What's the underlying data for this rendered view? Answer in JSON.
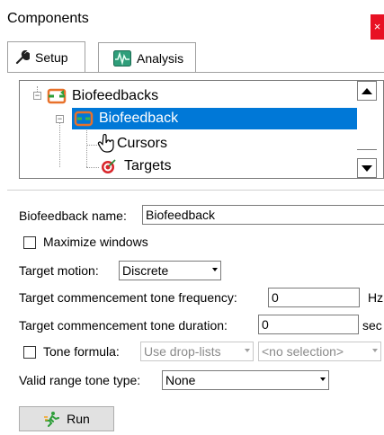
{
  "window": {
    "title": "Components",
    "close_glyph": "×"
  },
  "tabs": [
    {
      "label": "Setup",
      "icon": "wrench-icon",
      "active": true
    },
    {
      "label": "Analysis",
      "icon": "waveform-icon",
      "active": false
    }
  ],
  "tree": {
    "items": [
      {
        "label": "Biofeedbacks",
        "icon": "biofeedback-group-icon",
        "expanded": true,
        "selected": false
      },
      {
        "label": "Biofeedback",
        "icon": "biofeedback-icon",
        "expanded": true,
        "selected": true
      },
      {
        "label": "Cursors",
        "icon": "hand-cursor-icon",
        "selected": false
      },
      {
        "label": "Targets",
        "icon": "target-icon",
        "selected": false
      }
    ]
  },
  "form": {
    "name_label": "Biofeedback name:",
    "name_value": "Biofeedback",
    "maximize_label": "Maximize windows",
    "maximize_checked": false,
    "motion_label": "Target motion:",
    "motion_value": "Discrete",
    "freq_label": "Target commencement tone frequency:",
    "freq_value": "0",
    "freq_unit": "Hz",
    "dur_label": "Target commencement tone duration:",
    "dur_value": "0",
    "dur_unit": "sec",
    "formula_label": "Tone formula:",
    "formula_checked": false,
    "formula_mode": "Use drop-lists",
    "formula_selection": "<no selection>",
    "range_label": "Valid range tone type:",
    "range_value": "None"
  },
  "actions": {
    "run_label": "Run",
    "run_icon": "runner-icon"
  },
  "colors": {
    "selection": "#0078d7",
    "close": "#e81123"
  }
}
